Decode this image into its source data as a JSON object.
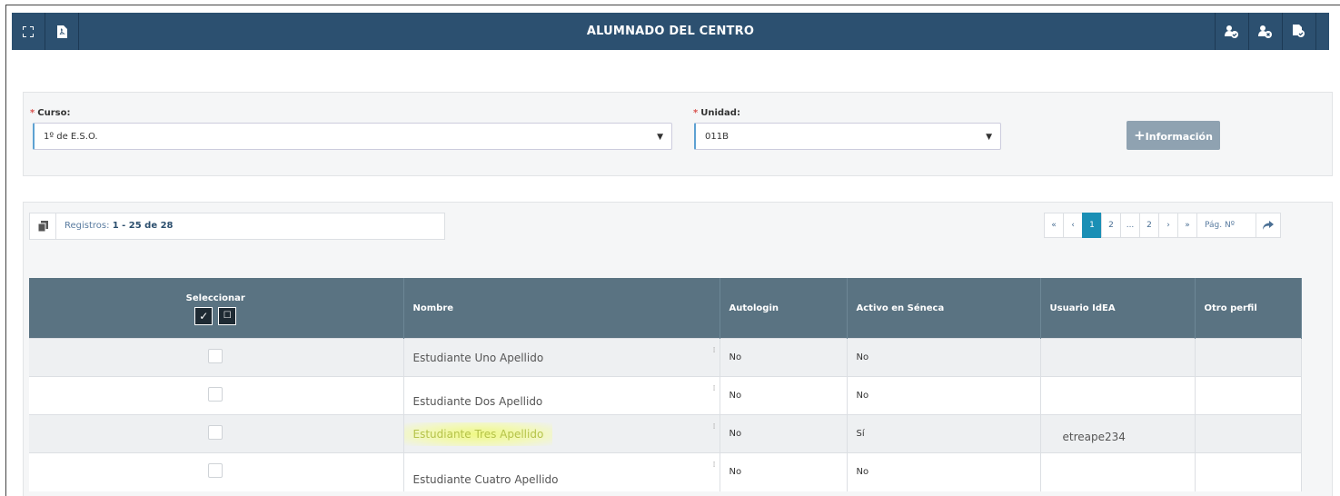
{
  "header": {
    "title": "ALUMNADO DEL CENTRO",
    "left_icons": [
      "fullscreen-icon",
      "pdf-icon"
    ],
    "right_icons": [
      "users-check-icon",
      "users-remove-icon",
      "document-check-icon"
    ]
  },
  "filters": {
    "curso_label": "Curso:",
    "curso_value": "1º de E.S.O.",
    "unidad_label": "Unidad:",
    "unidad_value": "011B",
    "required_mark": "*",
    "info_button": "Información",
    "info_icon": "plus-icon"
  },
  "records": {
    "prefix": "Registros:",
    "range": "1 - 25 de 28"
  },
  "pager": {
    "first": "«",
    "prev": "‹",
    "pages": [
      "1",
      "2",
      "...",
      "2"
    ],
    "active": "1",
    "next": "›",
    "last": "»",
    "page_input_placeholder": "Pág. Nº",
    "go_icon": "share-arrow-icon"
  },
  "table": {
    "columns": [
      "Seleccionar",
      "Nombre",
      "Autologin",
      "Activo en Séneca",
      "Usuario IdEA",
      "Otro perfil"
    ],
    "rows": [
      {
        "nombre": "Estudiante Uno Apellido",
        "autologin": "No",
        "activo": "No",
        "usuario": "",
        "otro": ""
      },
      {
        "nombre": "Estudiante Dos Apellido",
        "autologin": "No",
        "activo": "No",
        "usuario": "",
        "otro": ""
      },
      {
        "nombre": "Estudiante Tres Apellido",
        "autologin": "No",
        "activo": "Sí",
        "usuario": "etreape234",
        "otro": ""
      },
      {
        "nombre": "Estudiante Cuatro Apellido",
        "autologin": "No",
        "activo": "No",
        "usuario": "",
        "otro": ""
      }
    ]
  },
  "colors": {
    "header_bg": "#2c5070",
    "table_header_bg": "#5a7382",
    "active_page": "#1a8fb5",
    "info_button_bg": "#8fa2b1",
    "highlight": "#f0fa78"
  }
}
